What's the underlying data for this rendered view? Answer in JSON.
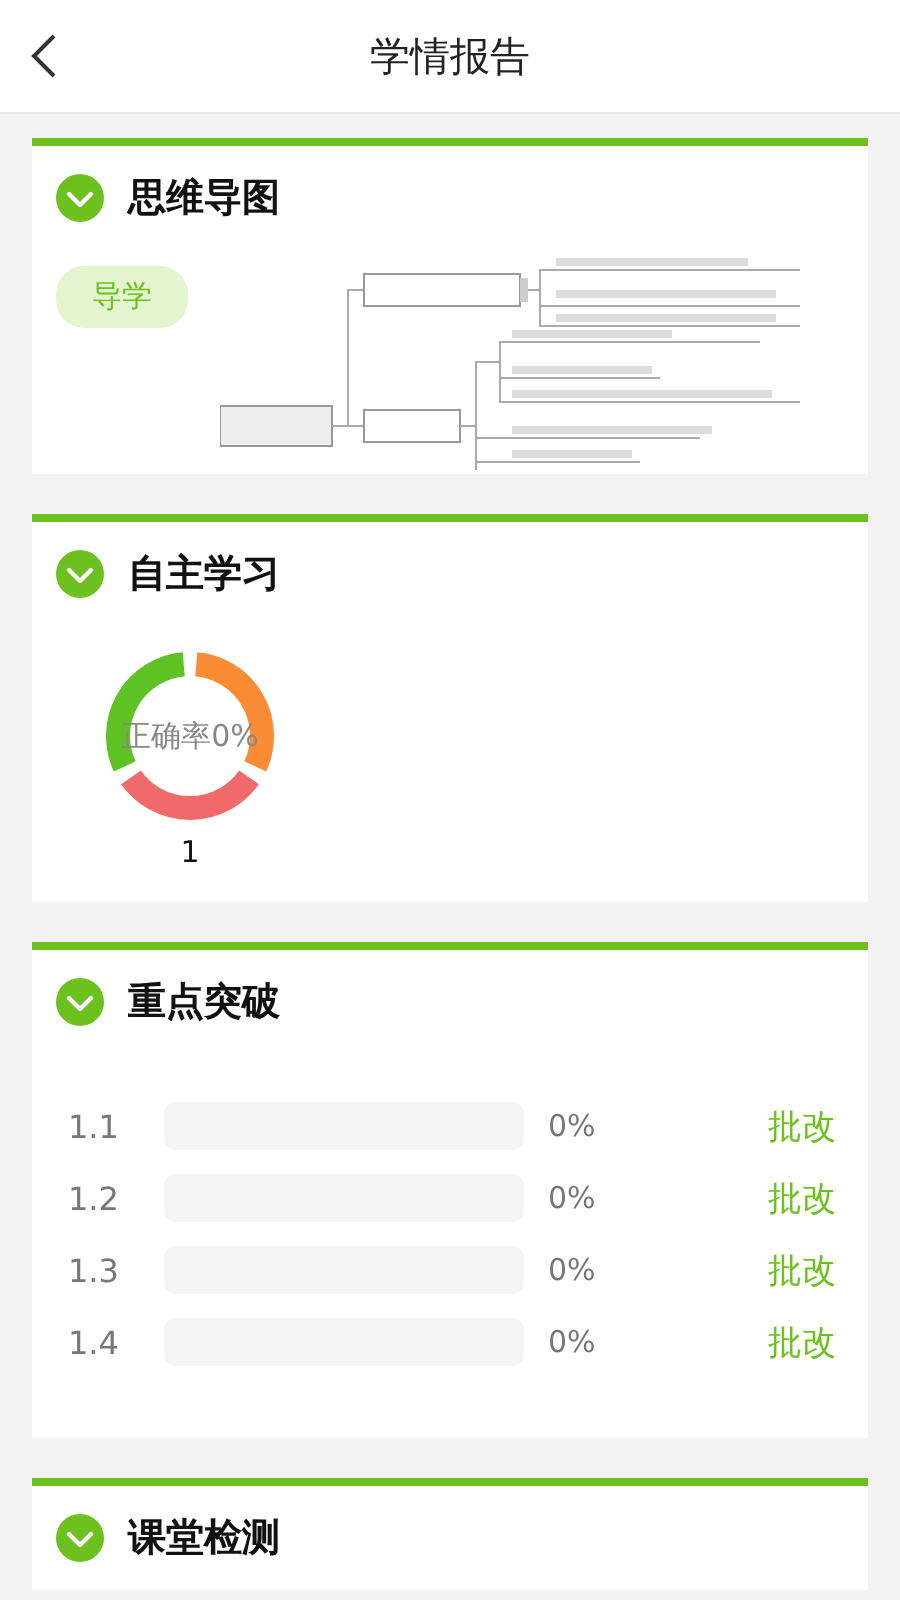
{
  "header": {
    "title": "学情报告"
  },
  "sections": [
    {
      "kind": "mindmap",
      "title": "思维导图",
      "tag": "导学"
    },
    {
      "kind": "donut",
      "title": "自主学习",
      "center_label": "正确率0%",
      "caption": "1"
    },
    {
      "kind": "progress",
      "title": "重点突破",
      "rows": [
        {
          "number": "1.1",
          "reading": "0%",
          "action": "批改"
        },
        {
          "number": "1.2",
          "reading": "0%",
          "action": "批改"
        },
        {
          "number": "1.3",
          "reading": "0%",
          "action": "批改"
        },
        {
          "number": "1.4",
          "reading": "0%",
          "action": "批改"
        }
      ]
    },
    {
      "kind": "plain",
      "title": "课堂检测"
    }
  ]
}
